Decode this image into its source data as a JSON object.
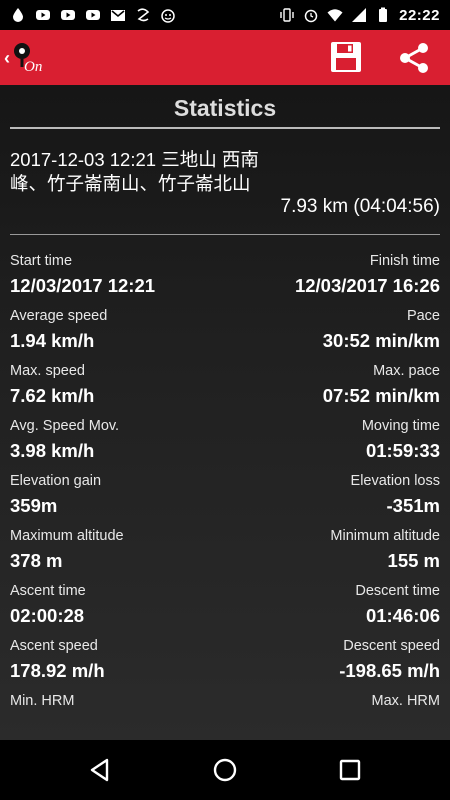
{
  "status_bar": {
    "time": "22:22",
    "icons_left": [
      "drop-icon",
      "youtube-icon",
      "youtube-icon",
      "youtube-icon",
      "gmail-icon",
      "app-icon",
      "smiley-icon"
    ],
    "icons_right": [
      "vibrate-icon",
      "alarm-icon",
      "wifi-icon",
      "signal-icon",
      "battery-icon"
    ]
  },
  "app_bar": {
    "back_glyph": "‹",
    "logo_text": "On",
    "accent_color": "#d91f31"
  },
  "page": {
    "title": "Statistics"
  },
  "summary": {
    "title": "2017-12-03 12:21 三地山 西南峰、竹子崙南山、竹子崙北山",
    "total": "7.93 km (04:04:56)"
  },
  "stats": [
    {
      "left_label": "Start time",
      "left_value": "12/03/2017 12:21",
      "right_label": "Finish time",
      "right_value": "12/03/2017 16:26"
    },
    {
      "left_label": "Average speed",
      "left_value": "1.94 km/h",
      "right_label": "Pace",
      "right_value": "30:52 min/km"
    },
    {
      "left_label": "Max. speed",
      "left_value": "7.62 km/h",
      "right_label": "Max. pace",
      "right_value": "07:52 min/km"
    },
    {
      "left_label": "Avg. Speed Mov.",
      "left_value": "3.98 km/h",
      "right_label": "Moving time",
      "right_value": "01:59:33"
    },
    {
      "left_label": "Elevation gain",
      "left_value": "359m",
      "right_label": "Elevation loss",
      "right_value": "-351m"
    },
    {
      "left_label": "Maximum altitude",
      "left_value": "378 m",
      "right_label": "Minimum altitude",
      "right_value": "155 m"
    },
    {
      "left_label": "Ascent time",
      "left_value": "02:00:28",
      "right_label": "Descent time",
      "right_value": "01:46:06"
    },
    {
      "left_label": "Ascent speed",
      "left_value": "178.92 m/h",
      "right_label": "Descent speed",
      "right_value": "-198.65 m/h"
    },
    {
      "left_label": "Min. HRM",
      "left_value": "",
      "right_label": "Max. HRM",
      "right_value": ""
    }
  ],
  "nav_bar": {
    "buttons": [
      "back-triangle-icon",
      "home-circle-icon",
      "recents-square-icon"
    ]
  }
}
